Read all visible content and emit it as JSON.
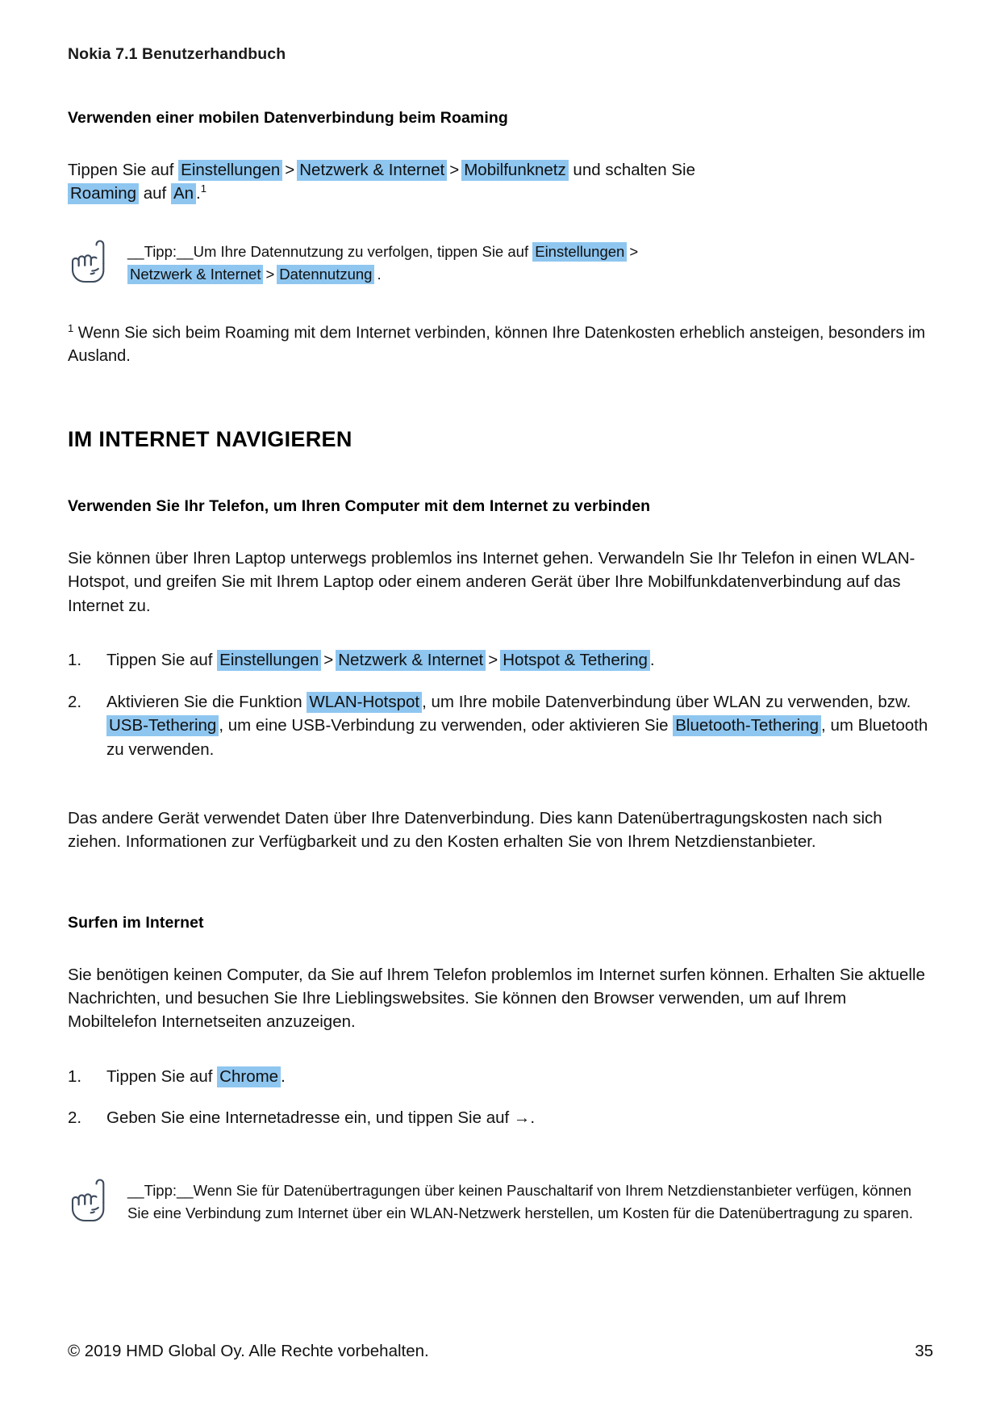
{
  "document": {
    "running_header": "Nokia 7.1 Benutzerhandbuch",
    "page_number": "35",
    "copyright": "© 2019 HMD Global Oy. Alle Rechte vorbehalten.",
    "highlight_color": "#8ec6f0",
    "icon_color": "#3d4a5c"
  },
  "roaming_section": {
    "heading": "Verwenden einer mobilen Datenverbindung beim Roaming",
    "instruction": {
      "lead": "Tippen Sie auf",
      "chip1": "Einstellungen",
      "sep1": ">",
      "chip2": "Netzwerk & Internet",
      "sep2": ">",
      "chip3": "Mobilfunknetz",
      "mid": "und schalten Sie",
      "chip4": "Roaming",
      "mid2": "auf",
      "chip5": "An",
      "period": ".",
      "footnote_marker": "1"
    },
    "tip": {
      "icon": "pointing-hand-icon",
      "prefix": "__Tipp:__",
      "text1": "Um Ihre Datennutzung zu verfolgen, tippen Sie auf",
      "chip1": "Einstellungen",
      "sep1": ">",
      "chip2": "Netzwerk & Internet",
      "sep2": ">",
      "chip3": "Datennutzung",
      "period": "."
    },
    "footnote": {
      "marker": "1",
      "text": "Wenn Sie sich beim Roaming mit dem Internet verbinden, können Ihre Datenkosten erheblich ansteigen, besonders im Ausland."
    }
  },
  "internet_section": {
    "heading": "IM INTERNET NAVIGIEREN",
    "tethering": {
      "heading": "Verwenden Sie Ihr Telefon, um Ihren Computer mit dem Internet zu verbinden",
      "paragraph": "Sie können über Ihren Laptop unterwegs problemlos ins Internet gehen. Verwandeln Sie Ihr Telefon in einen WLAN-Hotspot, und greifen Sie mit Ihrem Laptop oder einem anderen Gerät über Ihre Mobilfunkdatenverbindung auf das Internet zu.",
      "step1": {
        "lead": "Tippen Sie auf",
        "chip1": "Einstellungen",
        "sep1": ">",
        "chip2": "Netzwerk & Internet",
        "sep2": ">",
        "chip3": "Hotspot & Tethering",
        "period": "."
      },
      "step2": {
        "part1": "Aktivieren Sie die Funktion",
        "chip1": "WLAN-Hotspot",
        "part2": ", um Ihre mobile Datenverbindung über WLAN zu verwenden, bzw.",
        "chip2": "USB-Tethering",
        "part3": ", um eine USB-Verbindung zu verwenden, oder aktivieren Sie",
        "chip3": "Bluetooth-Tethering",
        "part4": ", um Bluetooth zu verwenden."
      },
      "closing_paragraph": "Das andere Gerät verwendet Daten über Ihre Datenverbindung. Dies kann Datenübertragungskosten nach sich ziehen. Informationen zur Verfügbarkeit und zu den Kosten erhalten Sie von Ihrem Netzdienstanbieter."
    },
    "surfing": {
      "heading": "Surfen im Internet",
      "paragraph": "Sie benötigen keinen Computer, da Sie auf Ihrem Telefon problemlos im Internet surfen können. Erhalten Sie aktuelle Nachrichten, und besuchen Sie Ihre Lieblingswebsites. Sie können den Browser verwenden, um auf Ihrem Mobiltelefon Internetseiten anzuzeigen.",
      "step1": {
        "lead": "Tippen Sie auf",
        "chip1": "Chrome",
        "period": "."
      },
      "step2": {
        "lead": "Geben Sie eine Internetadresse ein, und tippen Sie auf",
        "arrow": "→",
        "period": "."
      },
      "tip": {
        "icon": "pointing-hand-icon",
        "prefix": "__Tipp:__",
        "text": "Wenn Sie für Datenübertragungen über keinen Pauschaltarif von Ihrem Netzdienstanbieter verfügen, können Sie eine Verbindung zum Internet über ein WLAN-Netzwerk herstellen, um Kosten für die Datenübertragung zu sparen."
      }
    }
  }
}
